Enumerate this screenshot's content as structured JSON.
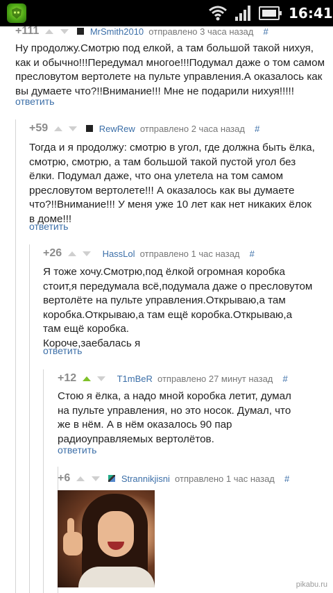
{
  "status_bar": {
    "time": "16:41",
    "icons": [
      "app-icon",
      "wifi-icon",
      "signal-icon",
      "battery-icon"
    ]
  },
  "comments": [
    {
      "score": "+111",
      "author": "MrSmith2010",
      "when": "отправлено 3 часа назад",
      "hash": "#",
      "text": "Ну продолжу.Смотрю под елкой, а там большой такой нихуя,\nкак и обычно!!!Передумал многое!!!Подумал даже о том самом\nпресловутом вертолете на пульте управления.А оказалось как\nвы думаете что?!!Внимание!!! Мне не подарили нихуя!!!!!",
      "reply": "ответить"
    },
    {
      "score": "+59",
      "author": "RewRew",
      "when": "отправлено 2 часа назад",
      "hash": "#",
      "text": "Тогда и я продолжу: смотрю в угол, где должна быть ёлка,\nсмотрю, смотрю, а там большой такой пустой угол без\nёлки. Подумал даже, что она улетела на том самом\npресловутом вертолете!!! А оказалось как вы думаете\nчто?!!Внимание!!! У меня уже 10 лет как нет никаких ёлок\nв доме!!!",
      "reply": "ответить"
    },
    {
      "score": "+26",
      "author": "HassLol",
      "when": "отправлено 1 час назад",
      "hash": "#",
      "text": "Я тоже хочу.Смотрю,под ёлкой огромная коробка\nстоит,я передумала всё,подумала даже о пресловутом\nвертолёте на пульте управления.Открываю,а там\nкоробка.Открываю,а там ещё коробка.Открываю,а\nтам ещё коробка.\nКороче,заебалась я",
      "reply": "ответить"
    },
    {
      "score": "+12",
      "author": "T1mBeR",
      "when": "отправлено 27 минут назад",
      "hash": "#",
      "text": "Стою я ёлка, а надо мной коробка летит, думал\nна пульте управления, но это носок. Думал, что\nже в нём. А в нём оказалось 90 пар\nрадиоуправляемых вертолётов.",
      "reply": "ответить"
    },
    {
      "score": "+6",
      "author": "Strannikjisni",
      "when": "отправлено 1 час назад",
      "hash": "#",
      "image": "photo-of-woman-thumbs-up"
    }
  ],
  "watermark": "pikabu.ru"
}
